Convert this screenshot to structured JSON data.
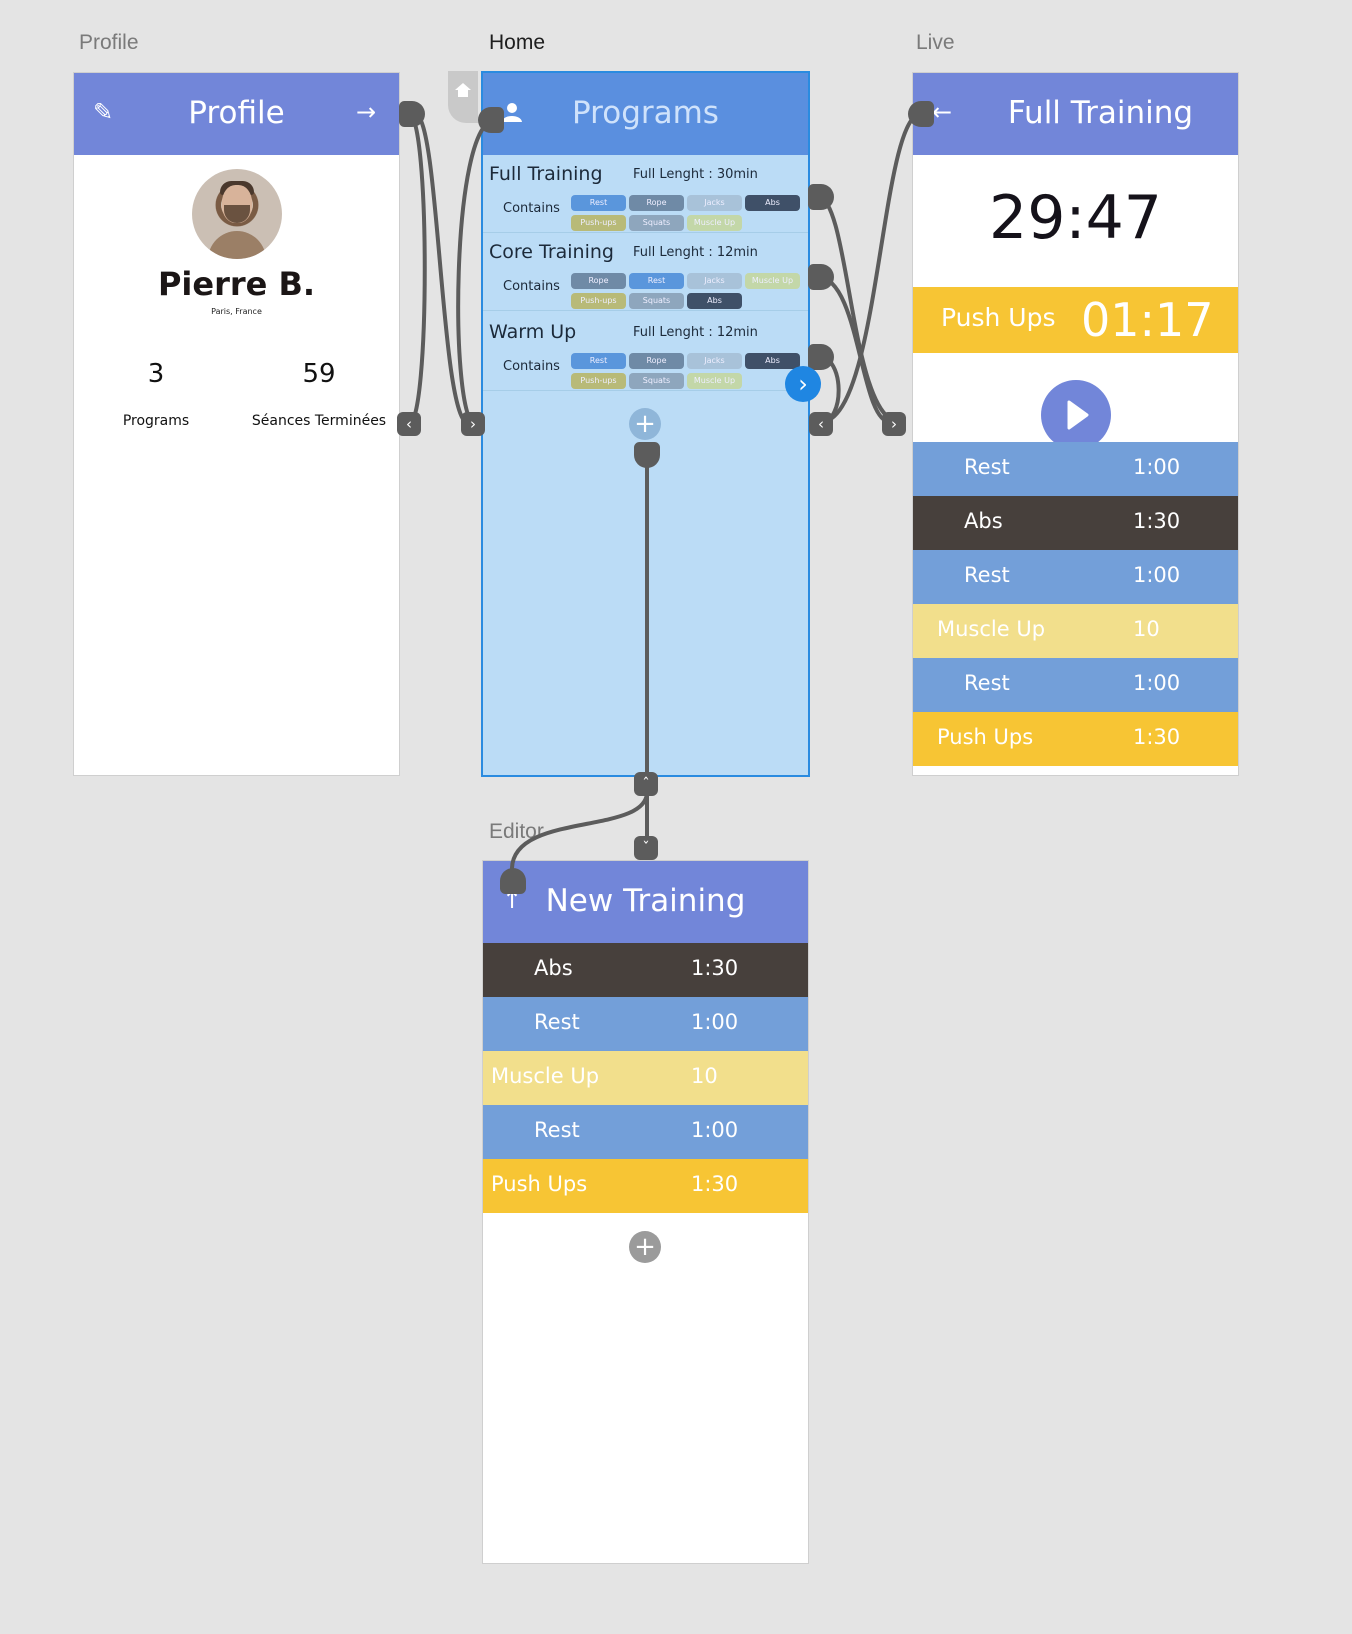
{
  "artboard_labels": {
    "profile": "Profile",
    "home": "Home",
    "live": "Live",
    "editor": "Editor"
  },
  "profile": {
    "title": "Profile",
    "name": "Pierre B.",
    "location": "Paris, France",
    "stats": [
      {
        "value": "3",
        "label": "Programs"
      },
      {
        "value": "59",
        "label": "Séances Terminées"
      }
    ]
  },
  "home": {
    "title": "Programs",
    "contains_label": "Contains",
    "programs": [
      {
        "title": "Full Training",
        "length": "Full Lenght : 30min",
        "tags": [
          "Rest",
          "Rope",
          "Jacks",
          "Abs",
          "Push-ups",
          "Squats",
          "Muscle Up"
        ]
      },
      {
        "title": "Core Training",
        "length": "Full Lenght : 12min",
        "tags": [
          "Rope",
          "Rest",
          "Jacks",
          "Muscle Up",
          "Push-ups",
          "Squats",
          "Abs"
        ]
      },
      {
        "title": "Warm Up",
        "length": "Full Lenght : 12min",
        "tags": [
          "Rest",
          "Rope",
          "Jacks",
          "Abs",
          "Push-ups",
          "Squats",
          "Muscle Up"
        ]
      }
    ]
  },
  "live": {
    "title": "Full Training",
    "total_time": "29:47",
    "current_exercise": "Push Ups",
    "current_time": "01:17",
    "rows": [
      {
        "name": "Rest",
        "value": "1:00",
        "color": "#739fd9"
      },
      {
        "name": "Abs",
        "value": "1:30",
        "color": "#47403c"
      },
      {
        "name": "Rest",
        "value": "1:00",
        "color": "#739fd9"
      },
      {
        "name": "Muscle Up",
        "value": "10",
        "color": "#f2df8c"
      },
      {
        "name": "Rest",
        "value": "1:00",
        "color": "#739fd9"
      },
      {
        "name": "Push Ups",
        "value": "1:30",
        "color": "#f7c534"
      }
    ]
  },
  "editor": {
    "title": "New Training",
    "rows": [
      {
        "name": "Abs",
        "value": "1:30",
        "color": "#47403c"
      },
      {
        "name": "Rest",
        "value": "1:00",
        "color": "#739fd9"
      },
      {
        "name": "Muscle Up",
        "value": "10",
        "color": "#f2df8c"
      },
      {
        "name": "Rest",
        "value": "1:00",
        "color": "#739fd9"
      },
      {
        "name": "Push Ups",
        "value": "1:30",
        "color": "#f7c534"
      }
    ]
  },
  "colors": {
    "header": "#7286d9",
    "home_header": "#5a8fdf",
    "home_bg": "#bbdcf6",
    "rest": "#739fd9",
    "abs": "#47403c",
    "muscle": "#f2df8c",
    "push": "#f7c534",
    "wire": "#5c5c5c",
    "selection": "#2a8be0"
  }
}
